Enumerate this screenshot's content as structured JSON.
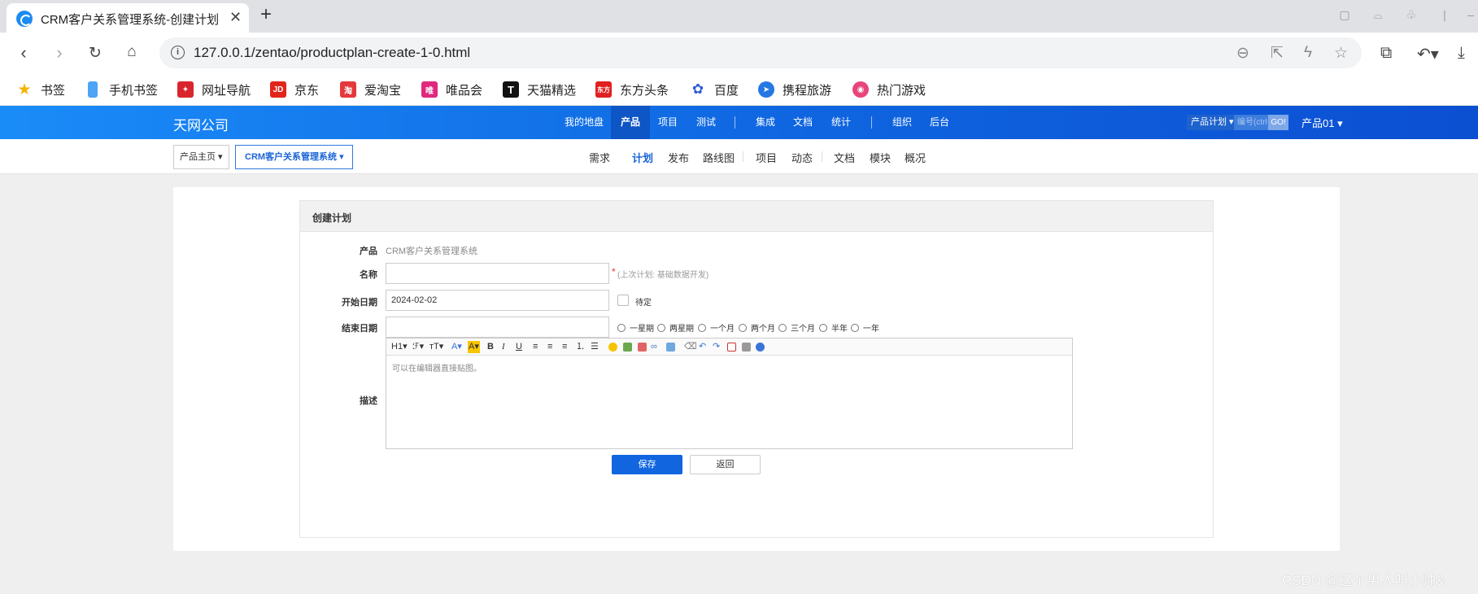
{
  "browser": {
    "tab_title": "CRM客户关系管理系统-创建计划",
    "tab_close": "✕",
    "new_tab": "+",
    "address": "127.0.0.1/zentao/productplan-create-1-0.html",
    "bookmarks": [
      {
        "label": "书签",
        "icon": "star-icon",
        "color": "#f5b400"
      },
      {
        "label": "手机书签",
        "icon": "phone-icon",
        "color": "#4da3f5"
      },
      {
        "label": "网址导航",
        "icon": "navigation-icon",
        "color": "#d9262d"
      },
      {
        "label": "京东",
        "icon": "jd-logo-icon",
        "color": "#e1251b",
        "glyph": "JD"
      },
      {
        "label": "爱淘宝",
        "icon": "taobao-icon",
        "color": "#e4393c",
        "glyph": "淘"
      },
      {
        "label": "唯品会",
        "icon": "vip-icon",
        "color": "#e0287d",
        "glyph": "唯"
      },
      {
        "label": "天猫精选",
        "icon": "tmall-icon",
        "color": "#111111",
        "glyph": "T"
      },
      {
        "label": "东方头条",
        "icon": "toutiao-icon",
        "color": "#e02020",
        "glyph": "东方"
      },
      {
        "label": "百度",
        "icon": "baidu-icon",
        "color": "#2f5bd6"
      },
      {
        "label": "携程旅游",
        "icon": "ctrip-icon",
        "color": "#2577e3"
      },
      {
        "label": "热门游戏",
        "icon": "game-icon",
        "color": "#e8457a"
      }
    ]
  },
  "app": {
    "company": "天网公司",
    "nav": [
      "我的地盘",
      "产品",
      "项目",
      "测试",
      "集成",
      "文档",
      "统计",
      "组织",
      "后台"
    ],
    "active_nav": "产品",
    "search_type": "产品计划",
    "search_placeholder": "编号(ctrl+g)",
    "search_go": "GO!",
    "user": "产品01",
    "breadcrumb_home": "产品主页",
    "breadcrumb_product": "CRM客户关系管理系统",
    "subnav": [
      "需求",
      "计划",
      "发布",
      "路线图",
      "项目",
      "动态",
      "文档",
      "模块",
      "概况"
    ],
    "active_subnav": "计划"
  },
  "form": {
    "title": "创建计划",
    "product_label": "产品",
    "product_value": "CRM客户关系管理系统",
    "name_label": "名称",
    "name_value": "",
    "name_required": "*",
    "name_hint": "(上次计划: 基础数据开发)",
    "begin_label": "开始日期",
    "begin_value": "2024-02-02",
    "pending_label": "待定",
    "end_label": "结束日期",
    "end_value": "",
    "durations": [
      "一星期",
      "两星期",
      "一个月",
      "两个月",
      "三个月",
      "半年",
      "一年"
    ],
    "desc_label": "描述",
    "desc_placeholder": "可以在编辑器直接贴图。",
    "toolbar": [
      "H1",
      "ℱ",
      "тT",
      "A",
      "A",
      "B",
      "I",
      "U"
    ],
    "save_label": "保存",
    "back_label": "返回"
  },
  "watermark": "CSDN @这个男人叫小帅&"
}
